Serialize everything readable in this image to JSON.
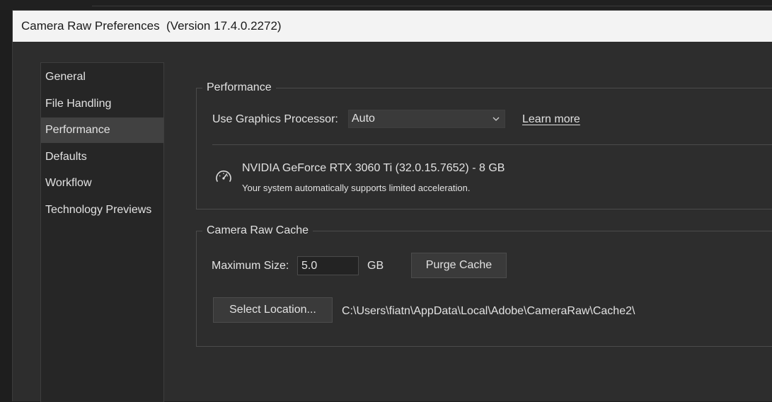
{
  "window": {
    "title": "Camera Raw Preferences  (Version 17.4.0.2272)"
  },
  "sidebar": {
    "items": [
      {
        "label": "General",
        "selected": false
      },
      {
        "label": "File Handling",
        "selected": false
      },
      {
        "label": "Performance",
        "selected": true
      },
      {
        "label": "Defaults",
        "selected": false
      },
      {
        "label": "Workflow",
        "selected": false
      },
      {
        "label": "Technology Previews",
        "selected": false
      }
    ]
  },
  "performance": {
    "title": "Performance",
    "gpu_label": "Use Graphics Processor:",
    "gpu_value": "Auto",
    "learn_more": "Learn more",
    "gpu_name": "NVIDIA GeForce RTX 3060 Ti (32.0.15.7652) - 8 GB",
    "gpu_status": "Your system automatically supports limited acceleration.",
    "gpu_icon": "gauge-icon"
  },
  "cache": {
    "title": "Camera Raw Cache",
    "max_size_label": "Maximum Size:",
    "max_size_value": "5.0",
    "unit": "GB",
    "purge_label": "Purge Cache",
    "select_location_label": "Select Location...",
    "location_path": "C:\\Users\\fiatn\\AppData\\Local\\Adobe\\CameraRaw\\Cache2\\"
  },
  "colors": {
    "window_bg": "#2d2d2d",
    "titlebar_bg": "#f3f3f3",
    "sidebar_bg": "#262626",
    "selected_bg": "#414141",
    "text": "#e2e2e2"
  }
}
